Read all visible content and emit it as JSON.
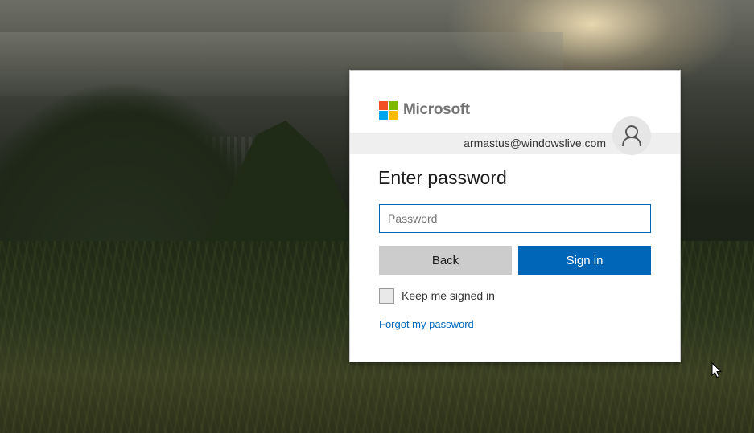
{
  "brand": {
    "name": "Microsoft",
    "colors": {
      "red": "#f25022",
      "green": "#7fba00",
      "blue": "#00a4ef",
      "yellow": "#ffb900"
    }
  },
  "account": {
    "email": "armastus@windowslive.com",
    "avatar_icon": "user-icon"
  },
  "form": {
    "title": "Enter password",
    "password_placeholder": "Password",
    "back_label": "Back",
    "signin_label": "Sign in",
    "keep_signed_in_label": "Keep me signed in",
    "keep_signed_in_checked": false,
    "forgot_link": "Forgot my password"
  },
  "theme": {
    "accent": "#0067b8",
    "back_button_bg": "#cccccc"
  }
}
